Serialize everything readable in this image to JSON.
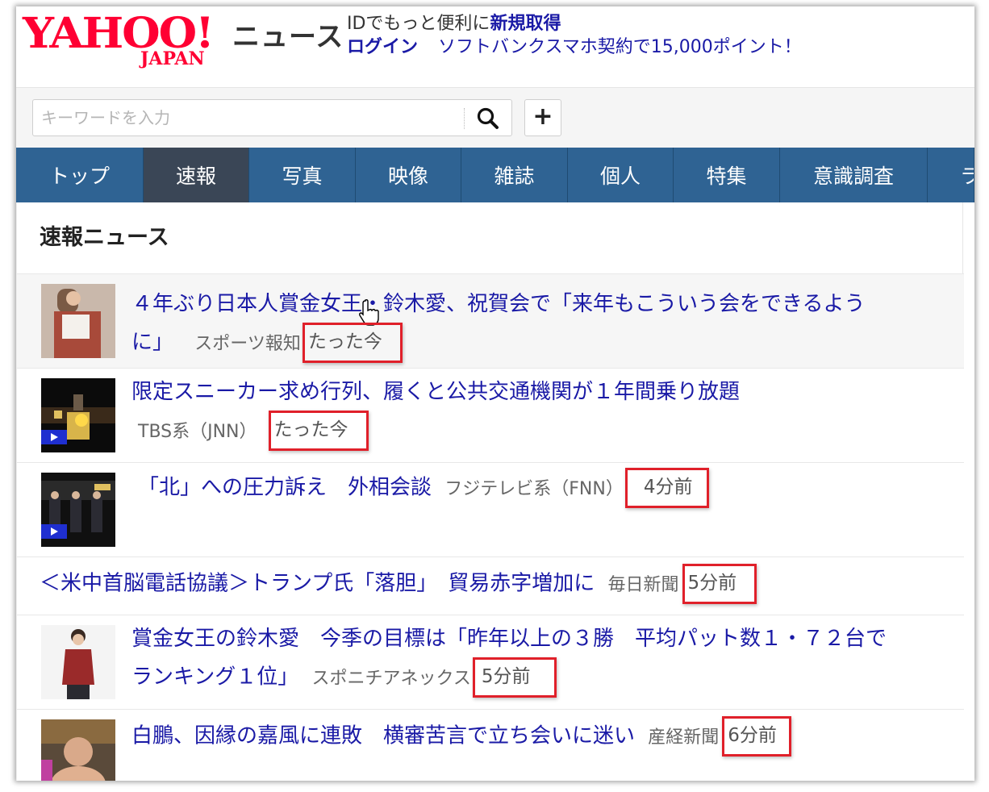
{
  "header": {
    "logo_text": "YAHOO!",
    "logo_sub": "JAPAN",
    "section_label": "ニュース",
    "promo_prefix": "IDでもっと便利に",
    "promo_signup": "新規取得",
    "login": "ログイン",
    "promo_link": "ソフトバンクスマホ契約で15,000ポイント！"
  },
  "search": {
    "placeholder": "キーワードを入力",
    "search_icon": "search-icon",
    "add_label": "+"
  },
  "nav": {
    "items": [
      {
        "label": "トップ",
        "active": false
      },
      {
        "label": "速報",
        "active": true
      },
      {
        "label": "写真",
        "active": false
      },
      {
        "label": "映像",
        "active": false
      },
      {
        "label": "雑誌",
        "active": false
      },
      {
        "label": "個人",
        "active": false
      },
      {
        "label": "特集",
        "active": false
      },
      {
        "label": "意識調査",
        "active": false
      },
      {
        "label": "ラ",
        "active": false
      }
    ]
  },
  "section": {
    "title": "速報ニュース"
  },
  "news": [
    {
      "title_line1": "４年ぶり日本人賞金女王・鈴木愛、祝賀会で「来年もこういう会をできるよう",
      "title_line2": "に」",
      "source": "スポーツ報知",
      "time": "たった今",
      "thumb": "photo",
      "video": false
    },
    {
      "title": "限定スニーカー求め行列、履くと公共交通機関が１年間乗り放題",
      "source": "TBS系（JNN）",
      "time": "たった今",
      "thumb": "video",
      "video": true
    },
    {
      "title": "「北」への圧力訴え　外相会談",
      "source": "フジテレビ系（FNN）",
      "time": "4分前",
      "thumb": "video",
      "video": true
    },
    {
      "title": "＜米中首脳電話協議＞トランプ氏「落胆」　貿易赤字増加に",
      "source": "毎日新聞",
      "time": "5分前",
      "thumb": "none",
      "video": false
    },
    {
      "title_line1": "賞金女王の鈴木愛　今季の目標は「昨年以上の３勝　平均パット数１・７２台で",
      "title_line2": "ランキング１位」",
      "source": "スポニチアネックス",
      "time": "5分前",
      "thumb": "photo",
      "video": false
    },
    {
      "title": "白鵬、因縁の嘉風に連敗　横審苦言で立ち会いに迷い",
      "source": "産経新聞",
      "time": "6分前",
      "thumb": "photo",
      "video": false
    }
  ],
  "colors": {
    "brand_red": "#ff0033",
    "nav_bg": "#2f6393",
    "nav_active": "#3a4656",
    "link": "#1a1aa6",
    "highlight_box": "#e0202a"
  }
}
